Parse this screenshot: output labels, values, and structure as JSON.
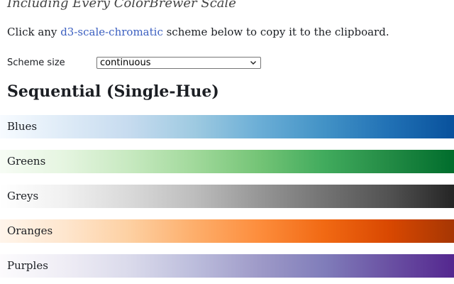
{
  "header": {
    "subtitle": "Including Every ColorBrewer Scale",
    "intro_prefix": "Click any ",
    "intro_link": "d3-scale-chromatic",
    "intro_suffix": " scheme below to copy it to the clipboard."
  },
  "controls": {
    "scheme_size_label": "Scheme size",
    "scheme_size_value": "continuous"
  },
  "section": {
    "title": "Sequential (Single-Hue)"
  },
  "schemes": [
    {
      "label": "Blues",
      "colors": [
        "#f7fbff",
        "#deebf7",
        "#c6dbef",
        "#9ecae1",
        "#6baed6",
        "#4292c6",
        "#2171b5",
        "#08519c"
      ]
    },
    {
      "label": "Greens",
      "colors": [
        "#f7fcf5",
        "#e5f5e0",
        "#c7e9c0",
        "#a1d99b",
        "#74c476",
        "#41ab5d",
        "#238b45",
        "#006d2c"
      ]
    },
    {
      "label": "Greys",
      "colors": [
        "#ffffff",
        "#f0f0f0",
        "#d9d9d9",
        "#bdbdbd",
        "#969696",
        "#737373",
        "#525252",
        "#252525"
      ]
    },
    {
      "label": "Oranges",
      "colors": [
        "#fff5eb",
        "#fee6ce",
        "#fdd0a2",
        "#fdae6b",
        "#fd8d3c",
        "#f16913",
        "#d94801",
        "#a63603"
      ]
    },
    {
      "label": "Purples",
      "colors": [
        "#fcfbfd",
        "#efedf5",
        "#dadaeb",
        "#bcbddc",
        "#9e9ac8",
        "#807dba",
        "#6a51a3",
        "#54278f"
      ]
    }
  ]
}
